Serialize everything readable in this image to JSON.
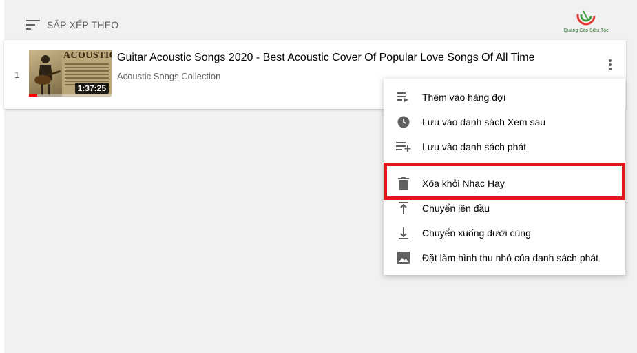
{
  "sort": {
    "label": "SẮP XẾP THEO",
    "icon": "sort-icon"
  },
  "logo": {
    "text": "Quảng Cáo Siêu Tốc"
  },
  "video": {
    "index": "1",
    "title": "Guitar Acoustic Songs 2020 - Best Acoustic Cover Of Popular Love Songs Of All Time",
    "channel": "Acoustic Songs Collection",
    "duration": "1:37:25",
    "thumbnail_text": "ACOUSTIC",
    "watched_progress": 0.1
  },
  "menu": {
    "items": [
      {
        "label": "Thêm vào hàng đợi",
        "icon": "add-to-queue-icon"
      },
      {
        "label": "Lưu vào danh sách Xem sau",
        "icon": "clock-icon"
      },
      {
        "label": "Lưu vào danh sách phát",
        "icon": "playlist-add-icon"
      },
      {
        "label": "Xóa khỏi Nhạc Hay",
        "icon": "trash-icon"
      },
      {
        "label": "Chuyển lên đầu",
        "icon": "move-to-top-icon"
      },
      {
        "label": "Chuyển xuống dưới cùng",
        "icon": "move-to-bottom-icon"
      },
      {
        "label": "Đặt làm hình thu nhỏ của danh sách phát",
        "icon": "image-icon"
      }
    ],
    "highlighted_item": "Xóa khỏi Nhạc Hay"
  },
  "colors": {
    "highlight_border": "#e2171e",
    "progress": "#ff0000",
    "icon": "#606060"
  }
}
